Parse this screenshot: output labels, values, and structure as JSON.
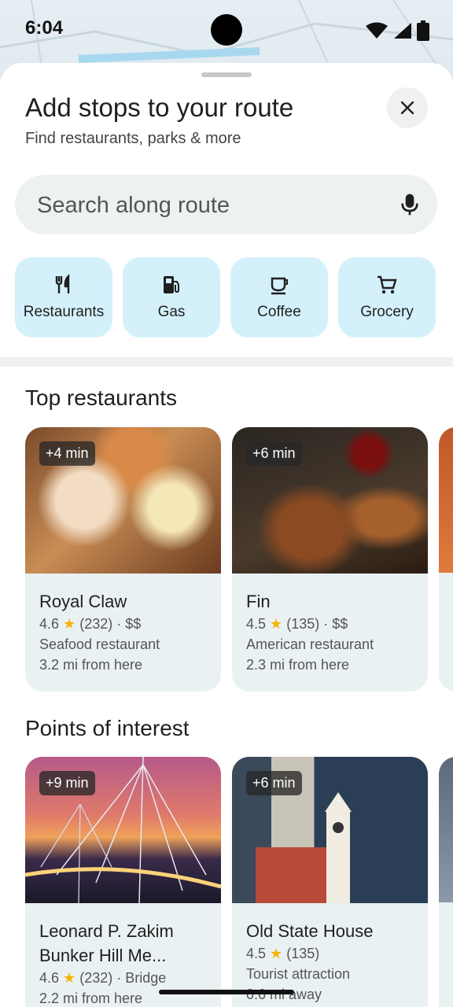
{
  "status": {
    "time": "6:04"
  },
  "sheet": {
    "title": "Add stops to your route",
    "subtitle": "Find restaurants, parks & more"
  },
  "search": {
    "placeholder": "Search along route"
  },
  "categories": [
    {
      "label": "Restaurants",
      "icon": "fork-knife-icon"
    },
    {
      "label": "Gas",
      "icon": "gas-pump-icon"
    },
    {
      "label": "Coffee",
      "icon": "coffee-cup-icon"
    },
    {
      "label": "Grocery",
      "icon": "shopping-cart-icon"
    }
  ],
  "sections": {
    "restaurants": {
      "title": "Top restaurants",
      "cards": [
        {
          "detour": "+4 min",
          "name": "Royal Claw",
          "rating": "4.6",
          "reviews": "(232)",
          "price": "$$",
          "type": "Seafood restaurant",
          "distance": "3.2 mi from here"
        },
        {
          "detour": "+6 min",
          "name": "Fin",
          "rating": "4.5",
          "reviews": "(135)",
          "price": "$$",
          "type": "American restaurant",
          "distance": "2.3 mi from here"
        }
      ]
    },
    "poi": {
      "title": "Points of interest",
      "cards": [
        {
          "detour": "+9 min",
          "name": "Leonard P. Zakim Bunker Hill Me...",
          "rating": "4.6",
          "reviews": "(232)",
          "category": "Bridge",
          "distance": "2.2 mi from here"
        },
        {
          "detour": "+6 min",
          "name": "Old State House",
          "rating": "4.5",
          "reviews": "(135)",
          "category": "Tourist attraction",
          "distance": "0.6 mi away"
        }
      ]
    }
  },
  "colors": {
    "chip_bg": "#d4f1fb",
    "card_bg": "#eaf1f3",
    "star": "#f4b400"
  }
}
